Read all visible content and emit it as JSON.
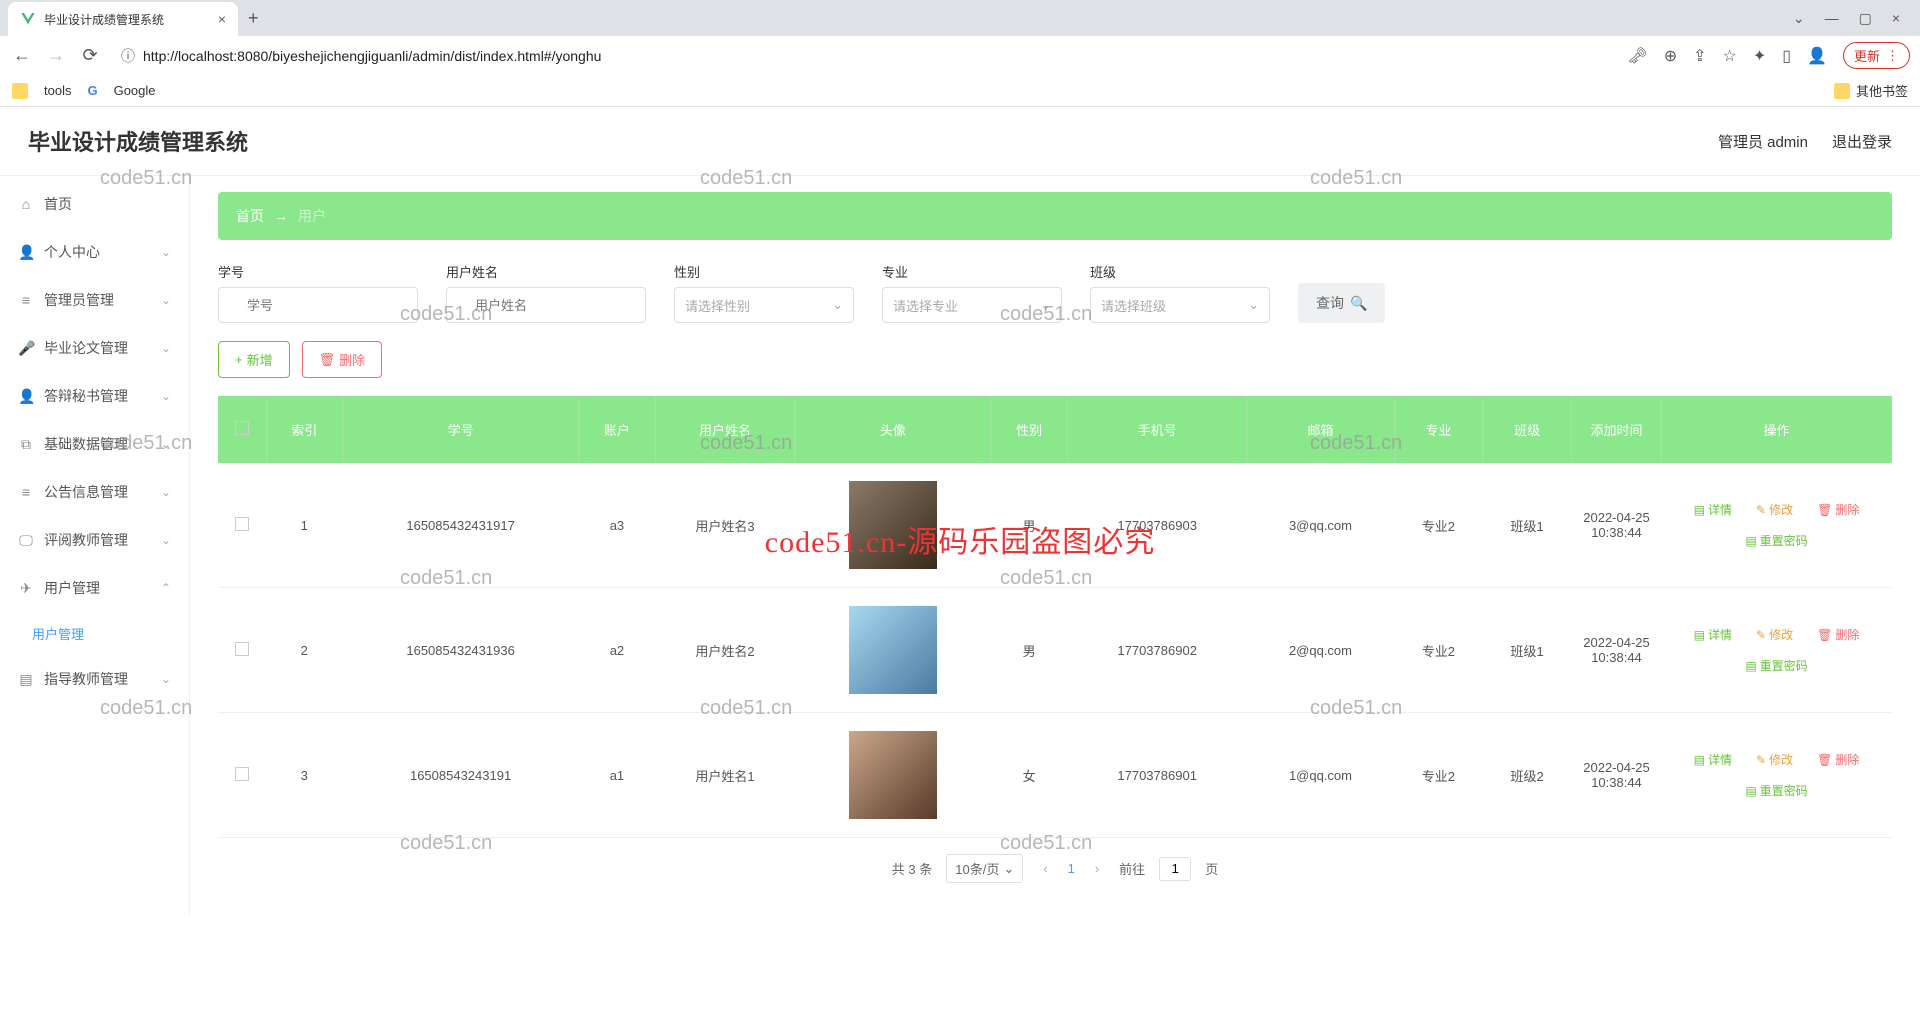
{
  "browser": {
    "tab_title": "毕业设计成绩管理系统",
    "url": "http://localhost:8080/biyeshejichengjiguanli/admin/dist/index.html#/yonghu",
    "upd_label": "更新",
    "bm_tools": "tools",
    "bm_google": "Google",
    "bm_other": "其他书签"
  },
  "header": {
    "title": "毕业设计成绩管理系统",
    "role": "管理员 admin",
    "logout": "退出登录"
  },
  "sidebar": {
    "home": "首页",
    "personal": "个人中心",
    "admin_mgmt": "管理员管理",
    "thesis_mgmt": "毕业论文管理",
    "defense_mgmt": "答辩秘书管理",
    "base_mgmt": "基础数据管理",
    "notice_mgmt": "公告信息管理",
    "reviewer_mgmt": "评阅教师管理",
    "user_mgmt": "用户管理",
    "user_mgmt_sub": "用户管理",
    "advisor_mgmt": "指导教师管理"
  },
  "breadcrumb": {
    "home": "首页",
    "arrow": "→",
    "current": "用户"
  },
  "filters": {
    "sid_label": "学号",
    "sid_ph": "学号",
    "name_label": "用户姓名",
    "name_ph": "用户姓名",
    "gender_label": "性别",
    "gender_ph": "请选择性别",
    "major_label": "专业",
    "major_ph": "请选择专业",
    "class_label": "班级",
    "class_ph": "请选择班级",
    "query": "查询"
  },
  "buttons": {
    "add": "新增",
    "del": "删除"
  },
  "table": {
    "headers": {
      "index": "索引",
      "sid": "学号",
      "account": "账户",
      "name": "用户姓名",
      "avatar": "头像",
      "gender": "性别",
      "phone": "手机号",
      "email": "邮箱",
      "major": "专业",
      "class": "班级",
      "add_time": "添加时间",
      "ops": "操作"
    },
    "rows": [
      {
        "idx": "1",
        "sid": "165085432431917",
        "acct": "a3",
        "name": "用户姓名3",
        "gender": "男",
        "phone": "17703786903",
        "email": "3@qq.com",
        "major": "专业2",
        "klass": "班级1",
        "time": "2022-04-25 10:38:44",
        "avclass": "av1"
      },
      {
        "idx": "2",
        "sid": "165085432431936",
        "acct": "a2",
        "name": "用户姓名2",
        "gender": "男",
        "phone": "17703786902",
        "email": "2@qq.com",
        "major": "专业2",
        "klass": "班级1",
        "time": "2022-04-25 10:38:44",
        "avclass": "av2"
      },
      {
        "idx": "3",
        "sid": "16508543243191",
        "acct": "a1",
        "name": "用户姓名1",
        "gender": "女",
        "phone": "17703786901",
        "email": "1@qq.com",
        "major": "专业2",
        "klass": "班级2",
        "time": "2022-04-25 10:38:44",
        "avclass": "av3"
      }
    ],
    "ops": {
      "detail": "详情",
      "edit": "修改",
      "del": "删除",
      "reset": "重置密码"
    }
  },
  "pager": {
    "total": "共 3 条",
    "size": "10条/页",
    "cur": "1",
    "goto": "前往",
    "goto_v": "1",
    "page": "页"
  },
  "watermarks": {
    "wm": "code51.cn",
    "overlay": "code51.cn-源码乐园盗图必究"
  }
}
